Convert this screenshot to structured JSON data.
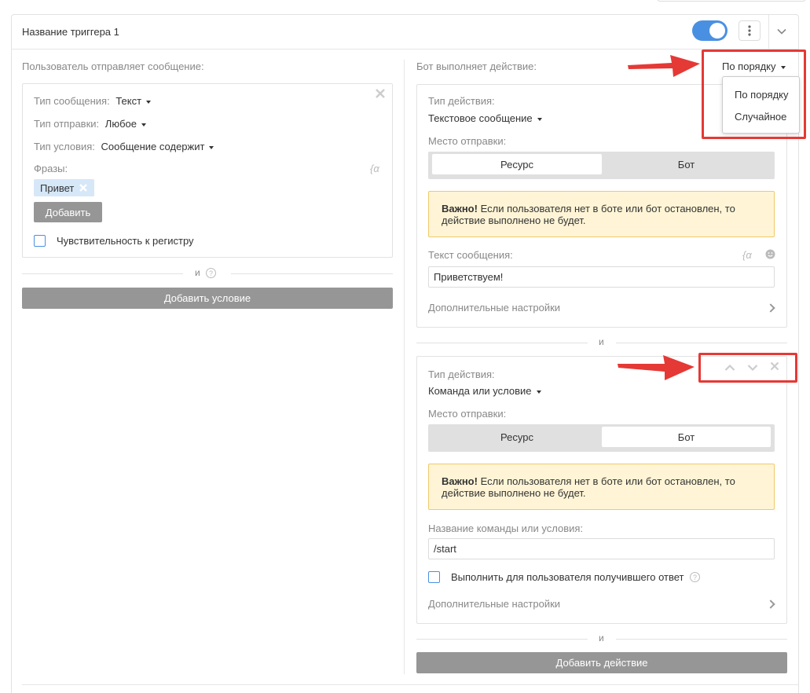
{
  "trigger": {
    "title": "Название триггера 1",
    "enabled": true
  },
  "left": {
    "heading": "Пользователь отправляет сообщение:",
    "condition": {
      "message_type_label": "Тип сообщения:",
      "message_type_value": "Текст",
      "send_type_label": "Тип отправки:",
      "send_type_value": "Любое",
      "condition_type_label": "Тип условия:",
      "condition_type_value": "Сообщение содержит",
      "phrases_label": "Фразы:",
      "phrases": [
        "Привет"
      ],
      "add_label": "Добавить",
      "case_sensitive_label": "Чувствительность к регистру",
      "case_sensitive_checked": false
    },
    "and_label": "и",
    "add_condition_label": "Добавить условие"
  },
  "right": {
    "heading": "Бот выполняет действие:",
    "order_value": "По порядку",
    "order_options": [
      "По порядку",
      "Случайное"
    ],
    "actions": [
      {
        "action_type_label": "Тип действия:",
        "action_type_value": "Текстовое сообщение",
        "place_label": "Место отправки:",
        "place_options": [
          "Ресурс",
          "Бот"
        ],
        "place_selected": "Ресурс",
        "warning_bold": "Важно!",
        "warning_line1": " Если пользователя нет в боте или бот остановлен, то",
        "warning_line2": "действие выполнено не будет.",
        "field_label": "Текст сообщения:",
        "field_value": "Приветствуем!",
        "extra_label": "Дополнительные настройки"
      },
      {
        "action_type_label": "Тип действия:",
        "action_type_value": "Команда или условие",
        "place_label": "Место отправки:",
        "place_options": [
          "Ресурс",
          "Бот"
        ],
        "place_selected": "Бот",
        "warning_bold": "Важно!",
        "warning_line1": " Если пользователя нет в боте или бот остановлен, то",
        "warning_line2": "действие выполнено не будет.",
        "field_label": "Название команды или условия:",
        "field_value": "/start",
        "checkbox_label": "Выполнить для пользователя получившего ответ",
        "checkbox_checked": false,
        "extra_label": "Дополнительные настройки"
      }
    ],
    "and_label": "и",
    "add_action_label": "Добавить действие"
  },
  "colors": {
    "accent": "#4a90e2",
    "annotation_red": "#e53935",
    "button_gray": "#969696",
    "warning_bg": "#fff5d6",
    "chip_bg": "#d6e7f8"
  }
}
